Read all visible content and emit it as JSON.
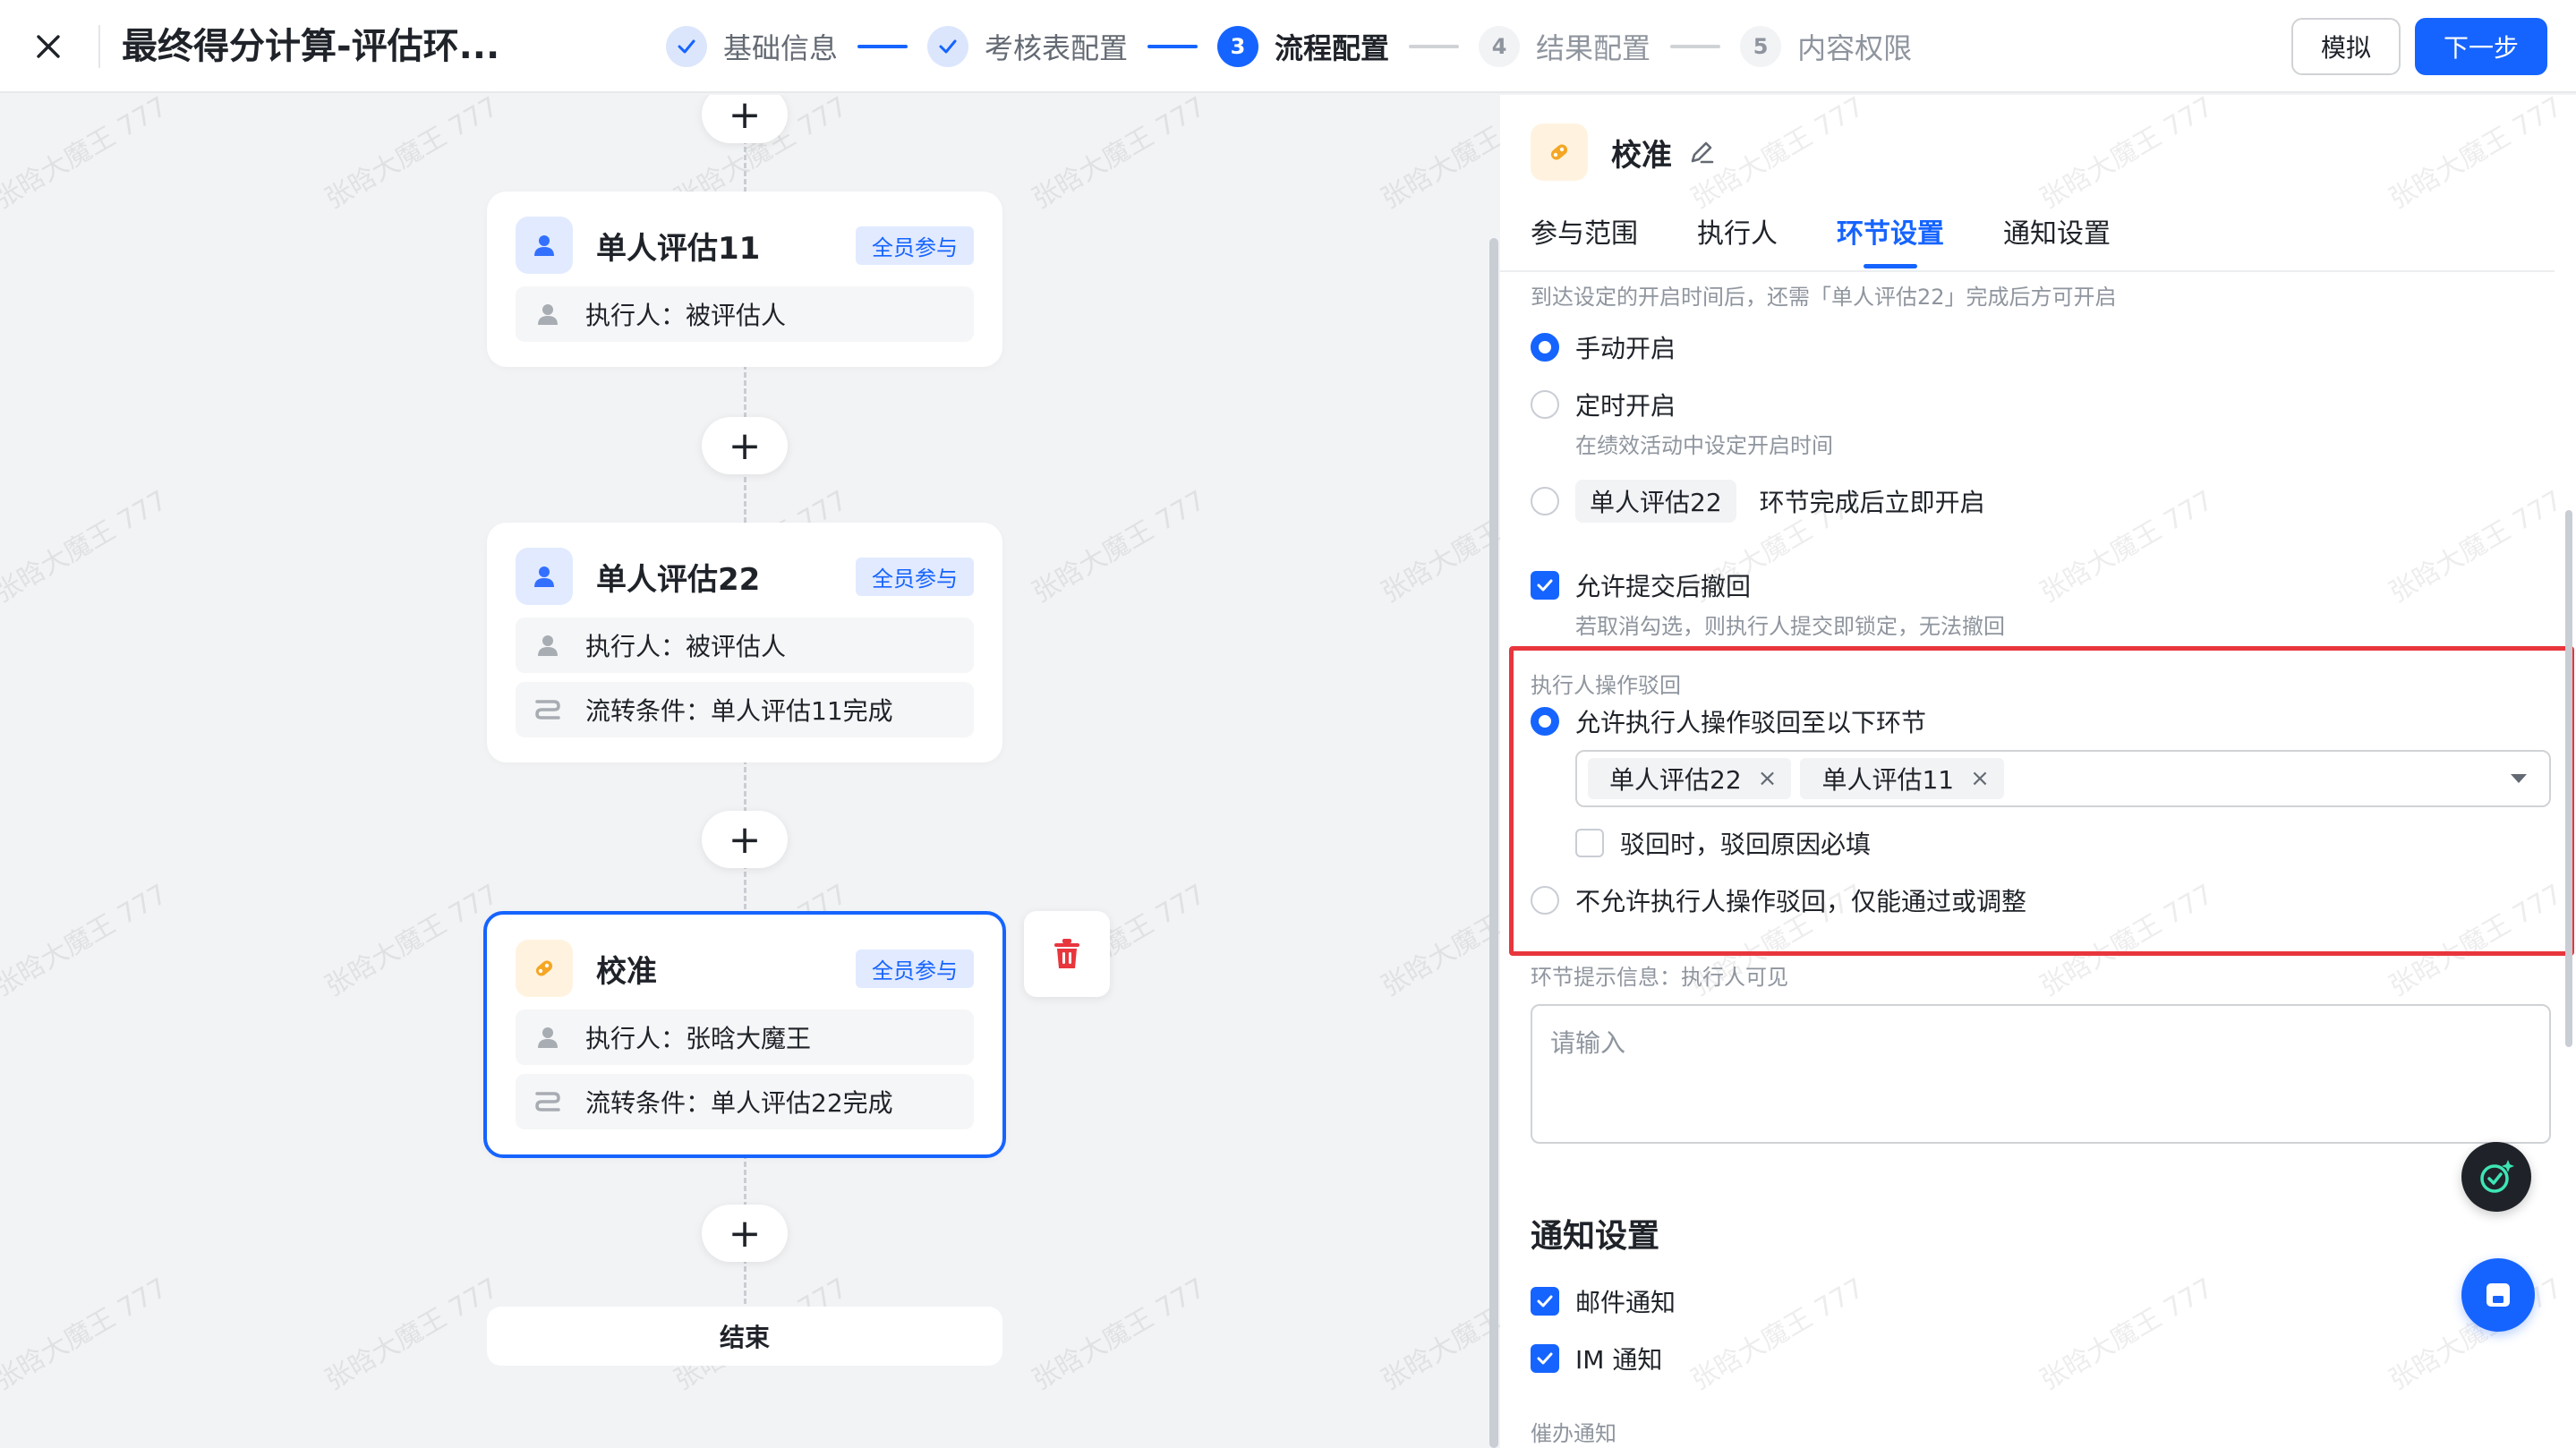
{
  "header": {
    "title": "最终得分计算-评估环...",
    "simulate_label": "模拟",
    "next_label": "下一步",
    "steps": [
      {
        "num": "",
        "label": "基础信息",
        "state": "done"
      },
      {
        "num": "",
        "label": "考核表配置",
        "state": "done"
      },
      {
        "num": "3",
        "label": "流程配置",
        "state": "active"
      },
      {
        "num": "4",
        "label": "结果配置",
        "state": "todo"
      },
      {
        "num": "5",
        "label": "内容权限",
        "state": "todo"
      }
    ]
  },
  "watermark": "张晗大魔王 777",
  "flow": {
    "nodes": [
      {
        "title": "单人评估11",
        "badge": "全员参与",
        "executor": "执行人：被评估人",
        "condition": ""
      },
      {
        "title": "单人评估22",
        "badge": "全员参与",
        "executor": "执行人：被评估人",
        "condition": "流转条件：单人评估11完成"
      },
      {
        "title": "校准",
        "badge": "全员参与",
        "executor": "执行人：张晗大魔王",
        "condition": "流转条件：单人评估22完成"
      }
    ],
    "add_symbol": "+",
    "end_label": "结束"
  },
  "panel": {
    "title": "校准",
    "tabs": [
      "参与范围",
      "执行人",
      "环节设置",
      "通知设置"
    ],
    "active_tab": 2,
    "start_hint": "到达设定的开启时间后，还需「单人评估22」完成后方可开启",
    "start_options": {
      "manual": "手动开启",
      "timed": "定时开启",
      "timed_hint": "在绩效活动中设定开启时间",
      "after_chip": "单人评估22",
      "after_text": "环节完成后立即开启"
    },
    "withdraw": {
      "label": "允许提交后撤回",
      "hint": "若取消勾选，则执行人提交即锁定，无法撤回"
    },
    "reject": {
      "section_label": "执行人操作驳回",
      "allow_label": "允许执行人操作驳回至以下环节",
      "tags": [
        "单人评估22",
        "单人评估11"
      ],
      "tag_remove": "×",
      "reason_required": "驳回时，驳回原因必填",
      "disallow_label": "不允许执行人操作驳回，仅能通过或调整"
    },
    "tip": {
      "label": "环节提示信息：执行人可见",
      "placeholder": "请输入"
    },
    "notify": {
      "title": "通知设置",
      "email": "邮件通知",
      "im": "IM 通知",
      "urge": "催办通知"
    }
  },
  "colors": {
    "primary": "#1664ff",
    "highlight": "#e8363d",
    "delete": "#e8363d",
    "calibrate_icon": "#f5a623"
  }
}
